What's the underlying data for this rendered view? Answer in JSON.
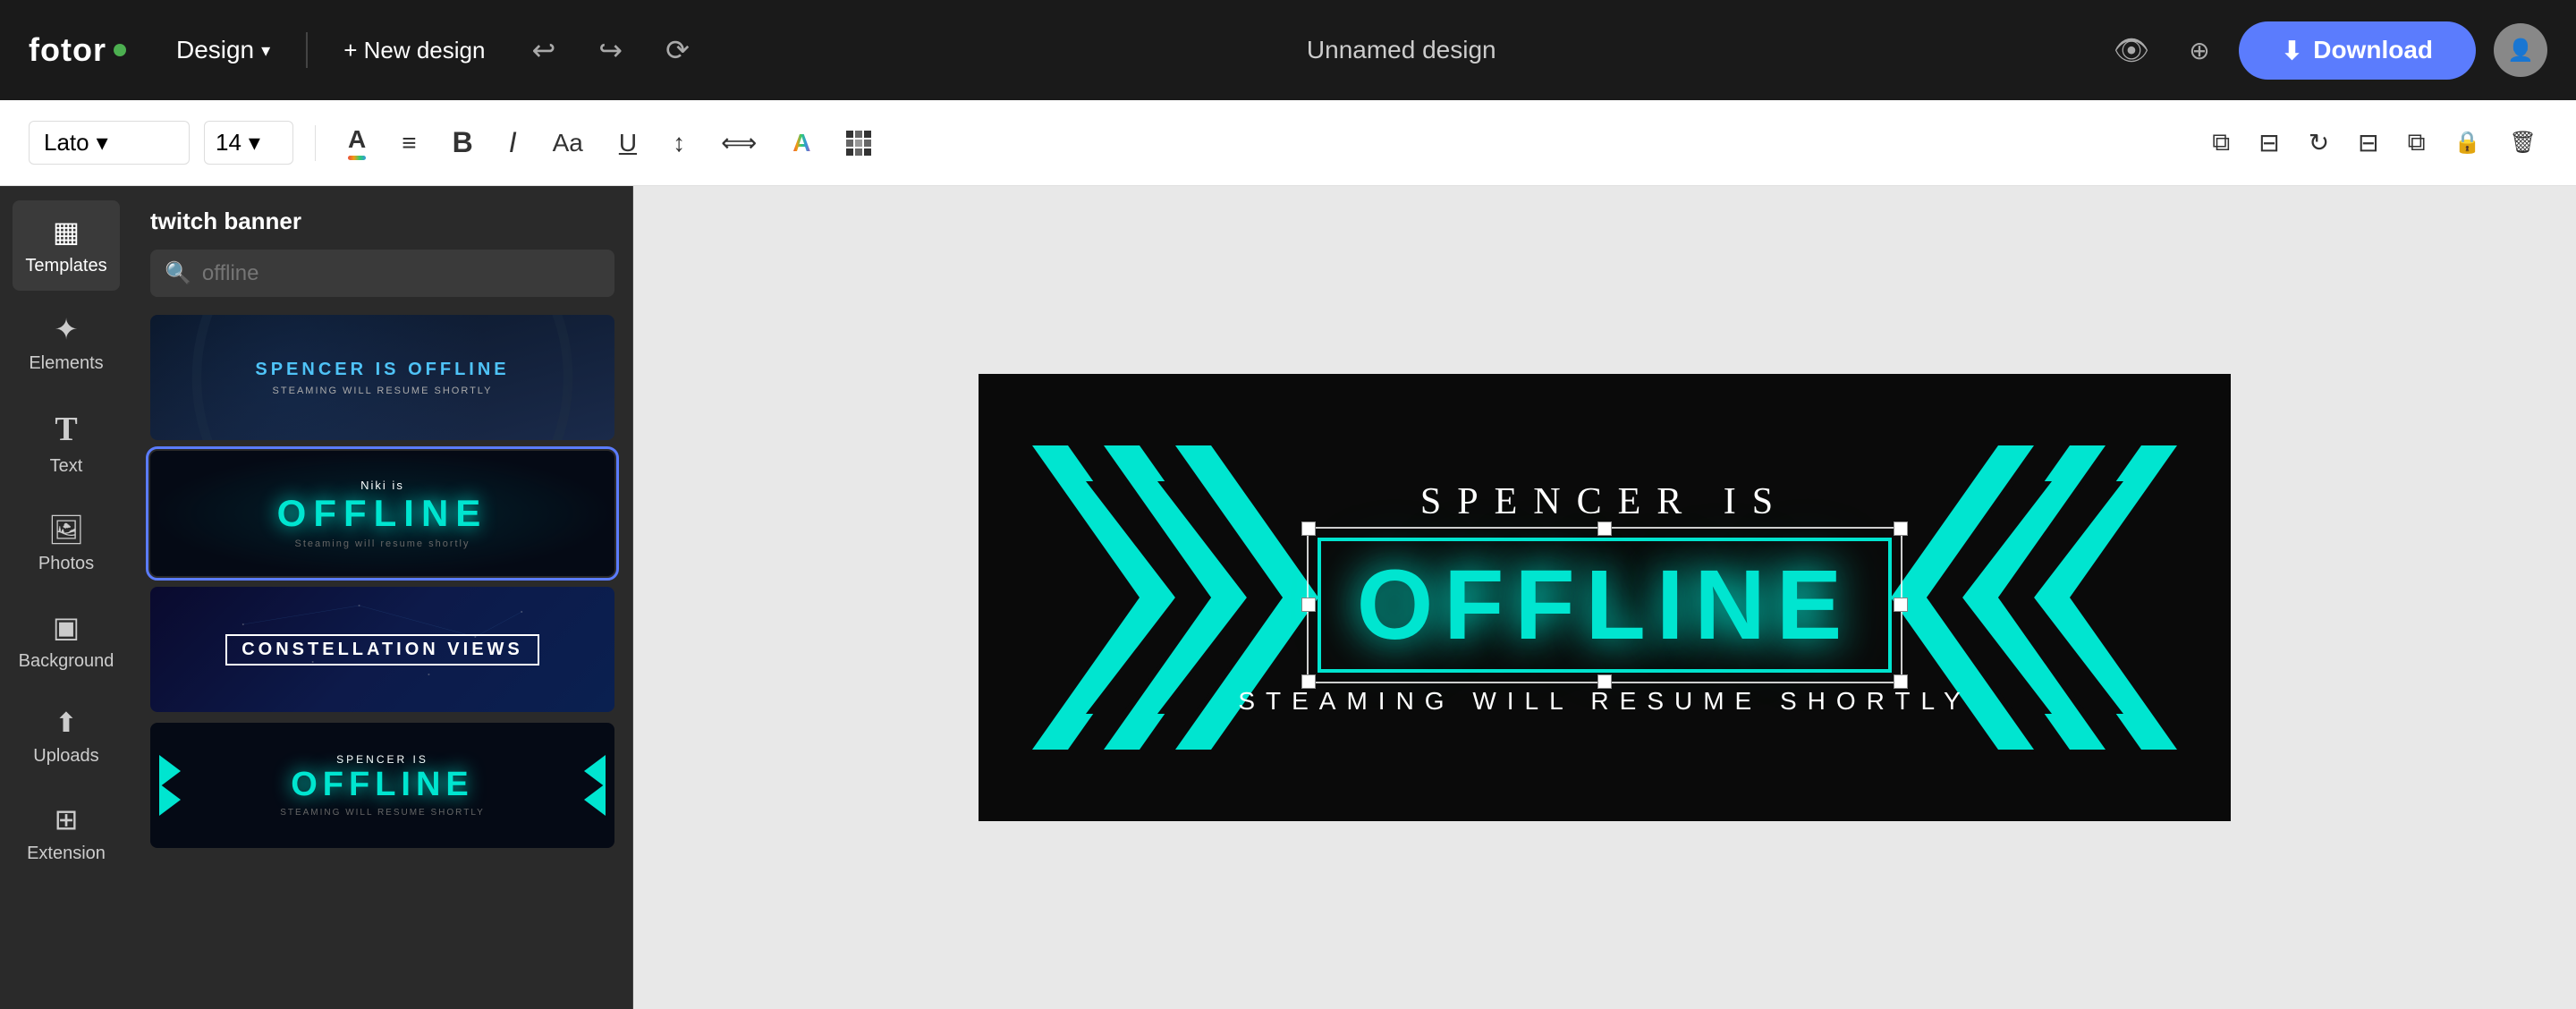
{
  "app": {
    "logo": "fotor",
    "logo_dot_color": "#4CAF50"
  },
  "topbar": {
    "design_label": "Design",
    "new_design_label": "+ New design",
    "design_title": "Unnamed design",
    "download_label": "Download",
    "undo_icon": "↩",
    "redo_icon": "↪",
    "history_icon": "⟳",
    "eye_icon": "👁",
    "share_icon": "⊕",
    "chevron_icon": "▾"
  },
  "toolbar": {
    "font_name": "Lato",
    "font_size": "14",
    "bold_label": "B",
    "italic_label": "I",
    "align_label": "≡",
    "text_transform_label": "Aa",
    "underline_label": "U",
    "line_height_label": "↕",
    "spacing_label": "⟺",
    "color_fill_label": "A",
    "effects_label": "A",
    "pattern_label": "⊞",
    "duplicate_icon": "⧉",
    "align_center_icon": "⊟",
    "rotate_icon": "↻",
    "align_h_icon": "⊟",
    "layers_icon": "⧉",
    "lock_icon": "🔒",
    "delete_icon": "🗑"
  },
  "sidebar": {
    "items": [
      {
        "id": "templates",
        "label": "Templates",
        "icon": "▦",
        "active": true
      },
      {
        "id": "elements",
        "label": "Elements",
        "icon": "✦",
        "active": false
      },
      {
        "id": "text",
        "label": "Text",
        "icon": "T",
        "active": false
      },
      {
        "id": "photos",
        "label": "Photos",
        "icon": "🖼",
        "active": false
      },
      {
        "id": "background",
        "label": "Background",
        "icon": "▣",
        "active": false
      },
      {
        "id": "uploads",
        "label": "Uploads",
        "icon": "↑",
        "active": false
      },
      {
        "id": "extension",
        "label": "Extension",
        "icon": "⧉",
        "active": false
      }
    ]
  },
  "template_panel": {
    "header": "twitch banner",
    "search_placeholder": "offline",
    "templates": [
      {
        "id": 1,
        "type": "dark-blue",
        "title": "SPENCER IS OFFLINE",
        "subtitle": "STEAMING WILL RESUME SHORTLY"
      },
      {
        "id": 2,
        "type": "dark-glow",
        "small": "Niki is",
        "big": "OFFLINE",
        "sub": "Steaming will resume shortly",
        "selected": true
      },
      {
        "id": 3,
        "type": "constellation",
        "title": "CONSTELLATION VIEWS"
      },
      {
        "id": 4,
        "type": "cyan-arrows",
        "small": "SPENCER IS",
        "big": "OFFLINE",
        "sub": "STEAMING WILL RESUME SHORTLY"
      }
    ]
  },
  "canvas": {
    "top_text": "SPENCER  IS",
    "main_text": "OFFLINE",
    "subtitle": "STEAMING WILL RESUME SHORTLY",
    "bg_color": "#0a0a0a",
    "accent_color": "#00e5d0"
  }
}
